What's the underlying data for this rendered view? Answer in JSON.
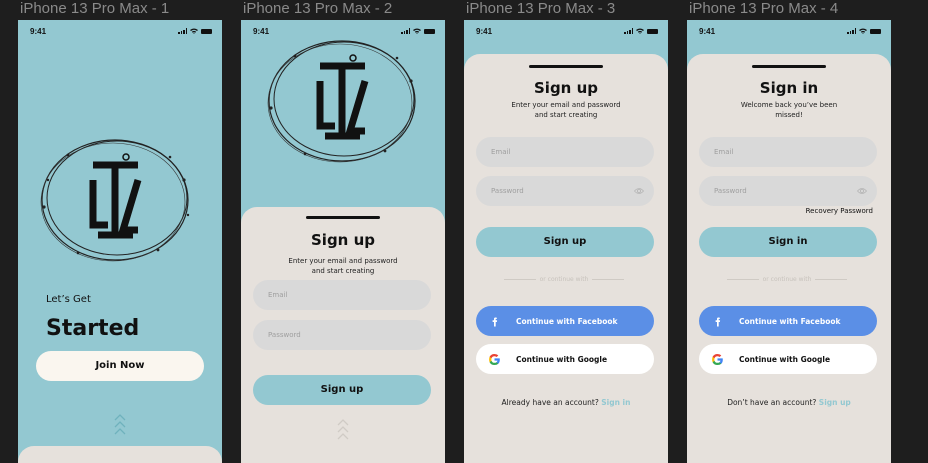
{
  "frames": [
    {
      "label": "iPhone 13 Pro Max - 1",
      "time": "9:41",
      "lets_get": "Let’s Get",
      "started": "Started",
      "join_now": "Join Now"
    },
    {
      "label": "iPhone 13 Pro Max - 2",
      "time": "9:41",
      "title": "Sign up",
      "subtitle": "Enter your email and password and start creating",
      "email_placeholder": "Email",
      "password_placeholder": "Password",
      "button": "Sign up"
    },
    {
      "label": "iPhone 13 Pro Max - 3",
      "time": "9:41",
      "title": "Sign up",
      "subtitle": "Enter your email and password and start creating",
      "email_placeholder": "Email",
      "password_placeholder": "Password",
      "button": "Sign up",
      "divider": "or continue with",
      "facebook": "Continue with Facebook",
      "google": "Continue with Google",
      "footer_text": "Already have an account?",
      "footer_link": "Sign in"
    },
    {
      "label": "iPhone 13 Pro Max - 4",
      "time": "9:41",
      "title": "Sign in",
      "subtitle": "Welcome back you’ve been missed!",
      "email_placeholder": "Email",
      "password_placeholder": "Password",
      "recovery": "Recovery Password",
      "button": "Sign in",
      "divider": "or continue with",
      "facebook": "Continue with Facebook",
      "google": "Continue with Google",
      "footer_text": "Don’t have an account?",
      "footer_link": "Sign up"
    }
  ],
  "colors": {
    "canvas": "#1e1e1e",
    "teal": "#93c8d1",
    "sheet": "#e6e1dc",
    "field": "#d9d9d9",
    "facebook": "#5b8fe6",
    "join_bg": "#faf6ef"
  },
  "icons": [
    "signal-icon",
    "wifi-icon",
    "battery-icon",
    "eye-icon",
    "facebook-icon",
    "google-icon",
    "chevron-up-icon",
    "logo-emblem"
  ]
}
